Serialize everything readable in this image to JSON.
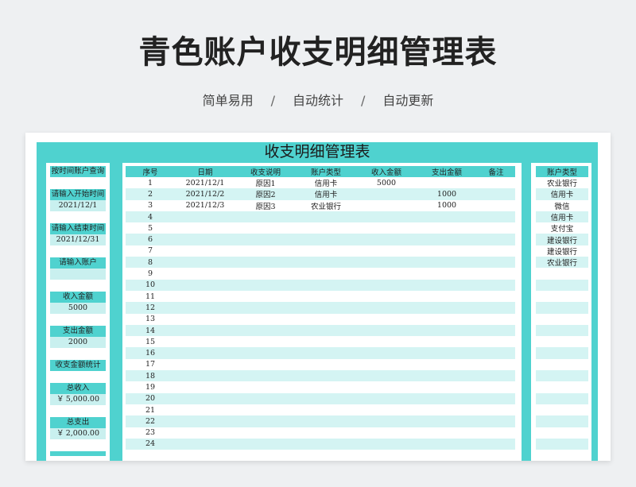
{
  "header": {
    "title": "青色账户收支明细管理表",
    "tags": [
      "简单易用",
      "自动统计",
      "自动更新"
    ],
    "separator": "/"
  },
  "sheet": {
    "title": "收支明细管理表"
  },
  "filter": {
    "heading": "按时间账户查询",
    "start_label": "请输入开始时间",
    "start_value": "2021/12/1",
    "end_label": "请输入结束时间",
    "end_value": "2021/12/31",
    "account_label": "请输入账户",
    "account_value": "",
    "income_label": "收入金额",
    "income_value": "5000",
    "expense_label": "支出金额",
    "expense_value": "2000",
    "stats_heading": "收支金额统计",
    "total_income_label": "总收入",
    "total_income_currency": "￥",
    "total_income_value": "5,000.00",
    "total_expense_label": "总支出",
    "total_expense_currency": "￥",
    "total_expense_value": "2,000.00"
  },
  "table": {
    "columns": [
      "序号",
      "日期",
      "收支说明",
      "账户类型",
      "收入金额",
      "支出金额",
      "备注"
    ],
    "rows": [
      [
        "1",
        "2021/12/1",
        "原因1",
        "信用卡",
        "5000",
        "",
        ""
      ],
      [
        "2",
        "2021/12/2",
        "原因2",
        "信用卡",
        "",
        "1000",
        ""
      ],
      [
        "3",
        "2021/12/3",
        "原因3",
        "农业银行",
        "",
        "1000",
        ""
      ],
      [
        "4",
        "",
        "",
        "",
        "",
        "",
        ""
      ],
      [
        "5",
        "",
        "",
        "",
        "",
        "",
        ""
      ],
      [
        "6",
        "",
        "",
        "",
        "",
        "",
        ""
      ],
      [
        "7",
        "",
        "",
        "",
        "",
        "",
        ""
      ],
      [
        "8",
        "",
        "",
        "",
        "",
        "",
        ""
      ],
      [
        "9",
        "",
        "",
        "",
        "",
        "",
        ""
      ],
      [
        "10",
        "",
        "",
        "",
        "",
        "",
        ""
      ],
      [
        "11",
        "",
        "",
        "",
        "",
        "",
        ""
      ],
      [
        "12",
        "",
        "",
        "",
        "",
        "",
        ""
      ],
      [
        "13",
        "",
        "",
        "",
        "",
        "",
        ""
      ],
      [
        "14",
        "",
        "",
        "",
        "",
        "",
        ""
      ],
      [
        "15",
        "",
        "",
        "",
        "",
        "",
        ""
      ],
      [
        "16",
        "",
        "",
        "",
        "",
        "",
        ""
      ],
      [
        "17",
        "",
        "",
        "",
        "",
        "",
        ""
      ],
      [
        "18",
        "",
        "",
        "",
        "",
        "",
        ""
      ],
      [
        "19",
        "",
        "",
        "",
        "",
        "",
        ""
      ],
      [
        "20",
        "",
        "",
        "",
        "",
        "",
        ""
      ],
      [
        "21",
        "",
        "",
        "",
        "",
        "",
        ""
      ],
      [
        "22",
        "",
        "",
        "",
        "",
        "",
        ""
      ],
      [
        "23",
        "",
        "",
        "",
        "",
        "",
        ""
      ],
      [
        "24",
        "",
        "",
        "",
        "",
        "",
        ""
      ]
    ]
  },
  "accounts": {
    "heading": "账户类型",
    "items": [
      "农业银行",
      "信用卡",
      "微信",
      "信用卡",
      "支付宝",
      "建设银行",
      "建设银行",
      "农业银行",
      "",
      "",
      "",
      "",
      "",
      "",
      "",
      "",
      "",
      "",
      "",
      "",
      "",
      "",
      "",
      ""
    ]
  },
  "colors": {
    "accent": "#4fd2cf",
    "stripe": "#d4f4f3",
    "light_cell": "#c9f0ef"
  }
}
